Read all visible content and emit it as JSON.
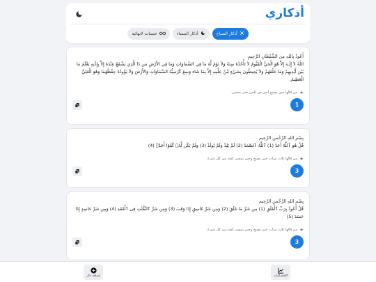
{
  "app": {
    "title": "أذكاري"
  },
  "tabs": [
    {
      "label": "أذكار الصباح",
      "icon": "sun-icon",
      "active": true
    },
    {
      "label": "أذكار المساء",
      "icon": "moon-icon",
      "active": false
    },
    {
      "label": "حسنات لانهائية",
      "icon": "infinity-icon",
      "active": false
    }
  ],
  "cards": [
    {
      "intro": "أَعُوذُ بِاللهِ مِنَ الشَّيْطَانِ الرَّجِيمِ",
      "body": "اللّهُ لاَ إِلَـهَ إِلاَّ هُوَ الْحَيُّ الْقَيُّومُ لاَ تَأْخُذُهُ سِنَةٌ وَلاَ نَوْمٌ لَّهُ مَا فِي السَّمَاوَاتِ وَمَا فِي الأَرْضِ مَن ذَا الَّذِي يَشْفَعُ عِنْدَهُ إِلاَّ بِإِذْنِهِ يَعْلَمُ مَا بَيْنَ أَيْدِيهِمْ وَمَا خَلْفَهُمْ وَلاَ يُحِيطُونَ بِشَيْءٍ مِّنْ عِلْمِهِ إِلاَّ بِمَا شَاء وَسِعَ كُرْسِيُّهُ السَّمَاوَاتِ وَالأَرْضَ وَلاَ يَؤُودُهُ حِفْظُهُمَا وَهُوَ الْعَلِيُّ الْعَظِيمُ.",
      "note": "من قالها حين يصبح أجير من الجن حتى يمسى.",
      "count": "1"
    },
    {
      "intro": "بِسْمِ اللهِ الرَّحْمنِ الرَّحِيم",
      "body": "قُلْ هُوَ ٱللَّهُ أَحَدٌ (1) ٱللَّهُ ٱلصَّمَدُ (2) لَمْ يَلِدْ وَلَمْ يُولَدْ (3) وَلَمْ يَكُن لَّهُۥ كُفُوًا أَحَدٌۢ (4)",
      "note": "من قالها ثلاث مرات حين يصبح وحين يمسى كفته من كل شىء.",
      "count": "3"
    },
    {
      "intro": "بِسْمِ اللهِ الرَّحْمنِ الرَّحِيم",
      "body": "قُلْ أَعُوذُ بِرَبِّ ٱلْفَلَقِ (1) مِن شَرِّ مَا خَلَقَ (2) وَمِن شَرِّ غَاسِقٍ إِذَا وَقَبَ (3) وَمِن شَرِّ ٱلنَّفَّٰثَٰتِ فِى ٱلْعُقَدِ (4) وَمِن شَرِّ حَاسِدٍ إِذَا حَسَدَ (5)",
      "note": "من قالها ثلاث مرات حين يصبح وحين يمسى كفته من كل شىء.",
      "count": "3"
    }
  ],
  "bottom_nav": {
    "stats_label": "الإحصائيات",
    "add_label": "إضافة ذكر"
  }
}
